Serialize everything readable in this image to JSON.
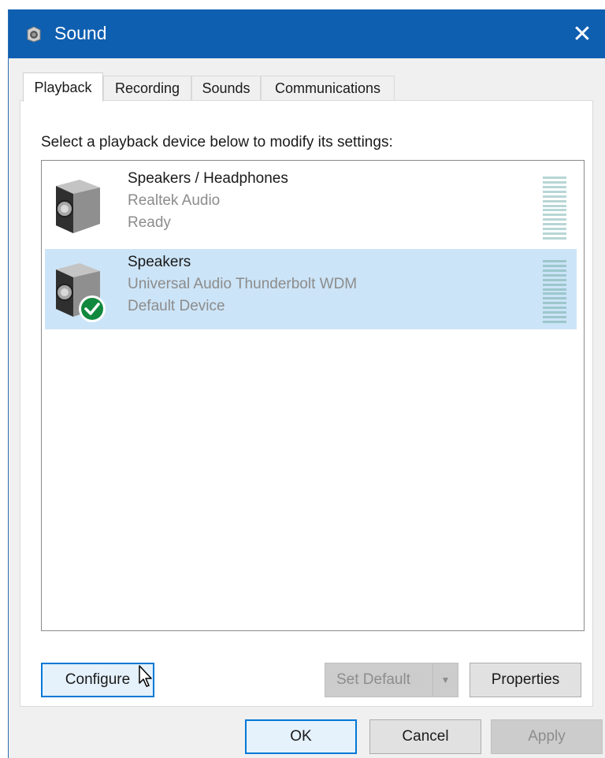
{
  "window": {
    "title": "Sound",
    "close_glyph": "✕"
  },
  "tabs": [
    {
      "label": "Playback",
      "active": true
    },
    {
      "label": "Recording",
      "active": false
    },
    {
      "label": "Sounds",
      "active": false
    },
    {
      "label": "Communications",
      "active": false
    }
  ],
  "playback": {
    "instruction": "Select a playback device below to modify its settings:",
    "devices": [
      {
        "name": "Speakers / Headphones",
        "description": "Realtek Audio",
        "status": "Ready",
        "selected": false,
        "is_default": false
      },
      {
        "name": "Speakers",
        "description": "Universal Audio Thunderbolt WDM",
        "status": "Default Device",
        "selected": true,
        "is_default": true
      }
    ],
    "buttons": {
      "configure": "Configure",
      "set_default": "Set Default",
      "properties": "Properties"
    }
  },
  "dialog_buttons": {
    "ok": "OK",
    "cancel": "Cancel",
    "apply": "Apply"
  },
  "colors": {
    "titlebar": "#0e5fb0",
    "selection": "#cce4f7",
    "default_check": "#10893e"
  },
  "icons": {
    "title": "speaker-icon",
    "device": "speaker-device-icon",
    "default_badge": "green-check-icon"
  }
}
